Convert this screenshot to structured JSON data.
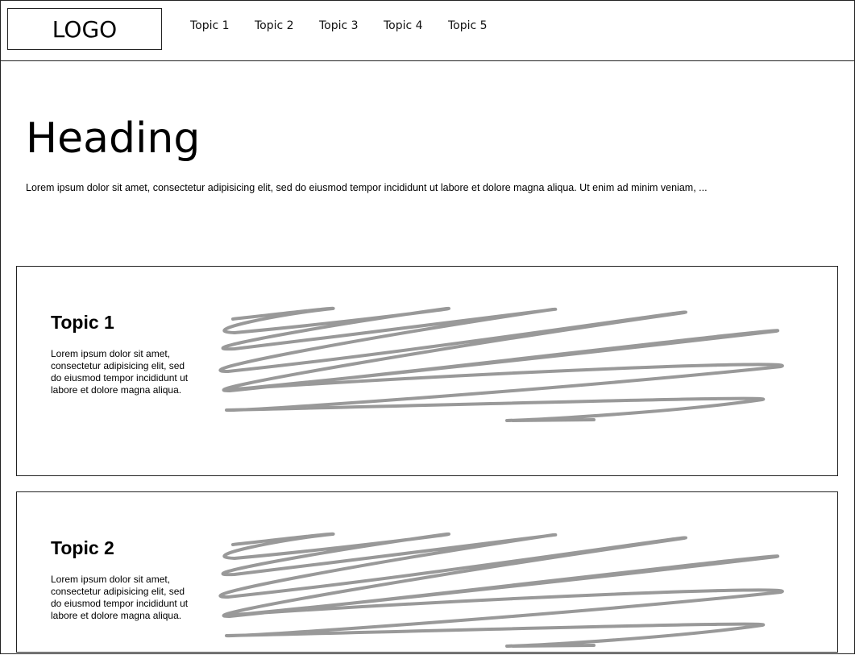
{
  "header": {
    "logo": "LOGO",
    "nav": [
      "Topic 1",
      "Topic 2",
      "Topic 3",
      "Topic 4",
      "Topic 5"
    ]
  },
  "main": {
    "heading": "Heading",
    "intro": "Lorem ipsum dolor sit amet, consectetur adipisicing elit, sed do eiusmod tempor incididunt ut labore et dolore magna aliqua. Ut enim ad minim veniam, ..."
  },
  "cards": [
    {
      "title": "Topic 1",
      "text": "Lorem ipsum dolor sit amet, consectetur adipisicing elit, sed do eiusmod tempor incididunt ut labore et dolore magna aliqua."
    },
    {
      "title": "Topic 2",
      "text": "Lorem ipsum dolor sit amet, consectetur adipisicing elit, sed do eiusmod tempor incididunt ut labore et dolore magna aliqua."
    }
  ],
  "colors": {
    "scribble": "#999999",
    "border": "#222222"
  }
}
